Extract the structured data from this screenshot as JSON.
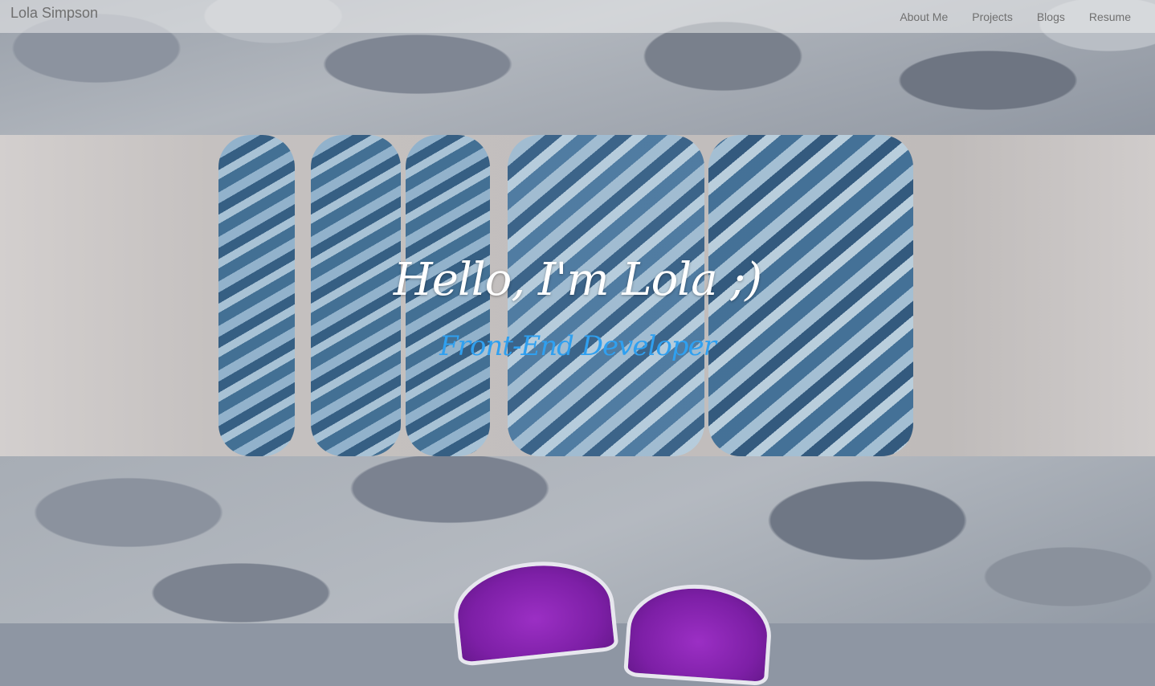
{
  "navbar": {
    "brand": "Lola Simpson",
    "links": [
      {
        "label": "About Me"
      },
      {
        "label": "Projects"
      },
      {
        "label": "Blogs"
      },
      {
        "label": "Resume"
      }
    ]
  },
  "hero": {
    "title": "Hello, I'm Lola ;)",
    "subtitle": "Front-End Developer",
    "subtitle_color": "#2fa0f0"
  }
}
